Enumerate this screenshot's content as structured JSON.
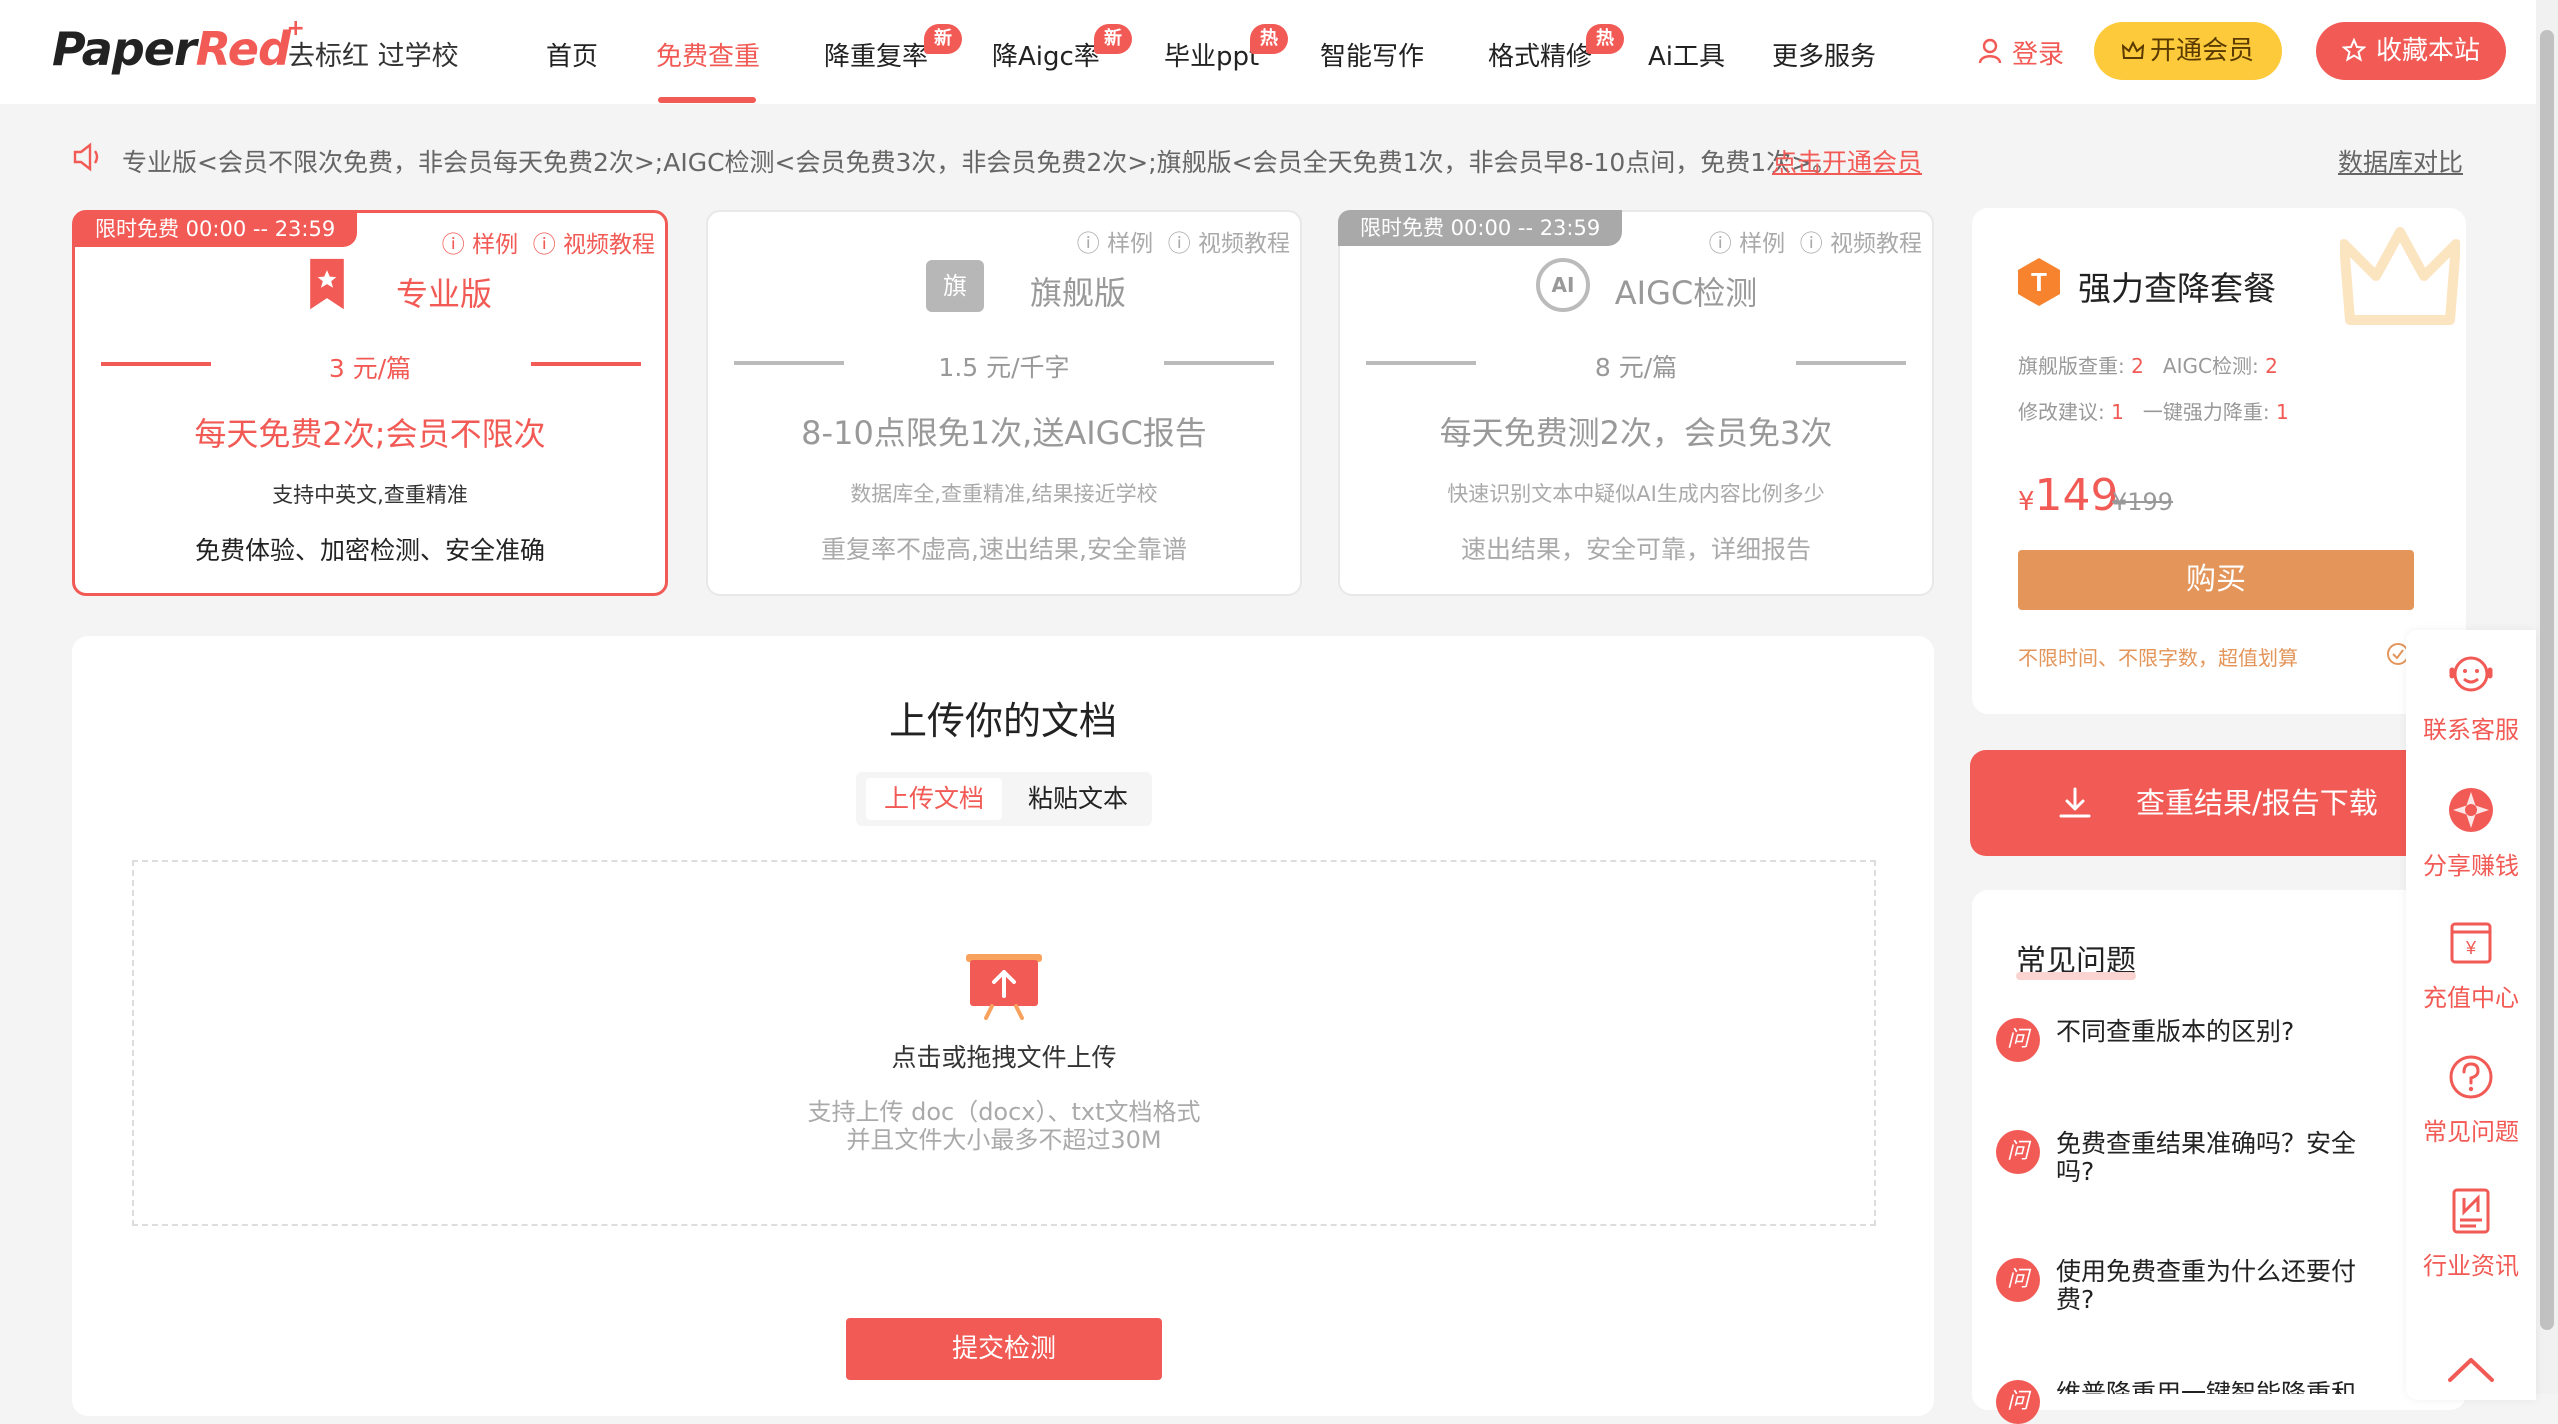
{
  "header": {
    "logo_main": "Paper",
    "logo_accent": "Red",
    "logo_plus": "+",
    "slogan": "去标红 过学校",
    "nav": [
      {
        "label": "首页"
      },
      {
        "label": "免费查重"
      },
      {
        "label": "降重复率",
        "badge": "新"
      },
      {
        "label": "降Aigc率",
        "badge": "新"
      },
      {
        "label": "毕业ppt",
        "badge": "热"
      },
      {
        "label": "智能写作"
      },
      {
        "label": "格式精修",
        "badge": "热"
      },
      {
        "label": "Ai工具"
      },
      {
        "label": "更多服务"
      }
    ],
    "login": "登录",
    "vip_button": "开通会员",
    "favorite_button": "收藏本站",
    "accent_color": "#f25a55"
  },
  "notice": {
    "text": "专业版<会员不限次免费，非会员每天免费2次>;AIGC检测<会员免费3次，非会员免费2次>;旗舰版<会员全天免费1次，非会员早8-10点间，免费1次>。",
    "link": "点击开通会员",
    "db_compare": "数据库对比"
  },
  "cards": [
    {
      "tag": "限时免费 00:00 -- 23:59",
      "sample": "样例",
      "video": "视频教程",
      "title": "专业版",
      "price": "3 元/篇",
      "headline": "每天免费2次;会员不限次",
      "sub": "支持中英文,查重精准",
      "bottom": "免费体验、加密检测、安全准确",
      "selected": true
    },
    {
      "tag": "",
      "sample": "样例",
      "video": "视频教程",
      "title": "旗舰版",
      "icon_text": "旗",
      "price": "1.5 元/千字",
      "headline": "8-10点限免1次,送AIGC报告",
      "sub": "数据库全,查重精准,结果接近学校",
      "bottom": "重复率不虚高,速出结果,安全靠谱",
      "selected": false
    },
    {
      "tag": "限时免费 00:00 -- 23:59",
      "sample": "样例",
      "video": "视频教程",
      "title": "AIGC检测",
      "icon_text": "AI",
      "price": "8 元/篇",
      "headline": "每天免费测2次，会员免3次",
      "sub": "快速识别文本中疑似AI生成内容比例多少",
      "bottom": "速出结果，安全可靠，详细报告",
      "selected": false
    }
  ],
  "upload": {
    "title": "上传你的文档",
    "tab_upload": "上传文档",
    "tab_paste": "粘贴文本",
    "drop_text": "点击或拖拽文件上传",
    "hint_line1": "支持上传 doc（docx）、txt文档格式",
    "hint_line2": "并且文件大小最多不超过30M",
    "submit": "提交检测"
  },
  "package": {
    "icon_letter": "T",
    "title": "强力查降套餐",
    "meta1_a_label": "旗舰版查重:",
    "meta1_a_value": "2",
    "meta1_b_label": "AIGC检测:",
    "meta1_b_value": "2",
    "meta2_a_label": "修改建议:",
    "meta2_a_value": "1",
    "meta2_b_label": "一键强力降重:",
    "meta2_b_value": "1",
    "currency": "¥",
    "price": "149",
    "original_price": "¥199",
    "buy": "购买",
    "note": "不限时间、不限字数，超值划算"
  },
  "download_button": "查重结果/报告下载",
  "faq": {
    "title": "常见问题",
    "icon_char": "问",
    "items": [
      {
        "q": "不同查重版本的区别?"
      },
      {
        "q": "免费查重结果准确吗？安全吗?"
      },
      {
        "q": "使用免费查重为什么还要付费?"
      },
      {
        "q": "维普降重用一键智能降重和格"
      }
    ]
  },
  "side_tools": [
    {
      "label": "联系客服",
      "icon": "headset-icon"
    },
    {
      "label": "分享赚钱",
      "icon": "share-icon"
    },
    {
      "label": "充值中心",
      "icon": "wallet-icon"
    },
    {
      "label": "常见问题",
      "icon": "question-icon"
    },
    {
      "label": "行业资讯",
      "icon": "news-icon"
    }
  ]
}
